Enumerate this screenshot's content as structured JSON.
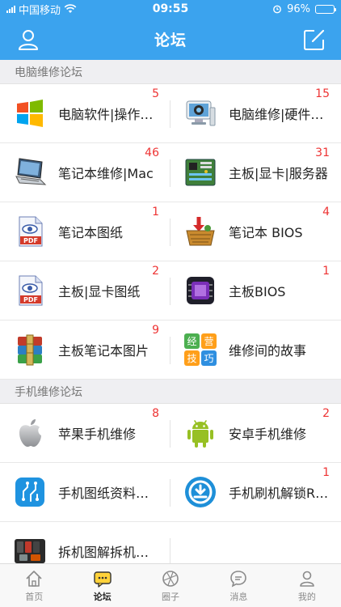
{
  "status_bar": {
    "carrier": "中国移动",
    "time": "09:55",
    "battery": "96%",
    "battery_level": 0.96
  },
  "nav": {
    "title": "论坛",
    "left_icon": "user-icon",
    "right_icon": "compose-icon"
  },
  "sections": [
    {
      "title": "电脑维修论坛",
      "items": [
        {
          "label": "电脑软件|操作系统",
          "badge": "5",
          "icon": "windows-icon"
        },
        {
          "label": "电脑维修|硬件维修",
          "badge": "15",
          "icon": "computer-repair-icon"
        },
        {
          "label": "笔记本维修|Mac",
          "badge": "46",
          "icon": "laptop-icon"
        },
        {
          "label": "主板|显卡|服务器",
          "badge": "31",
          "icon": "motherboard-icon"
        },
        {
          "label": "笔记本图纸",
          "badge": "1",
          "icon": "pdf-icon"
        },
        {
          "label": "笔记本 BIOS",
          "badge": "4",
          "icon": "basket-download-icon"
        },
        {
          "label": "主板|显卡图纸",
          "badge": "2",
          "icon": "pdf-icon"
        },
        {
          "label": "主板BIOS",
          "badge": "1",
          "icon": "chip-icon"
        },
        {
          "label": "主板笔记本图片",
          "badge": "9",
          "icon": "archive-icon"
        },
        {
          "label": "维修间的故事",
          "badge": "",
          "icon": "tips-tiles-icon",
          "tiles": [
            "经",
            "营",
            "技",
            "巧"
          ]
        }
      ]
    },
    {
      "title": "手机维修论坛",
      "items": [
        {
          "label": "苹果手机维修",
          "badge": "8",
          "icon": "apple-icon"
        },
        {
          "label": "安卓手机维修",
          "badge": "2",
          "icon": "android-icon"
        },
        {
          "label": "手机图纸资料下载",
          "badge": "",
          "icon": "schematic-icon"
        },
        {
          "label": "手机刷机解锁ROM",
          "badge": "1",
          "icon": "flash-rom-icon"
        },
        {
          "label": "拆机图解拆机视频",
          "badge": "",
          "icon": "teardown-icon"
        }
      ]
    }
  ],
  "tabs": [
    {
      "label": "首页",
      "icon": "home-icon",
      "active": false
    },
    {
      "label": "论坛",
      "icon": "forum-icon",
      "active": true
    },
    {
      "label": "圈子",
      "icon": "circle-icon",
      "active": false
    },
    {
      "label": "消息",
      "icon": "message-icon",
      "active": false
    },
    {
      "label": "我的",
      "icon": "profile-icon",
      "active": false
    }
  ],
  "colors": {
    "primary": "#3ba3ee",
    "badge": "#e33333",
    "section_bg": "#efeff2"
  }
}
